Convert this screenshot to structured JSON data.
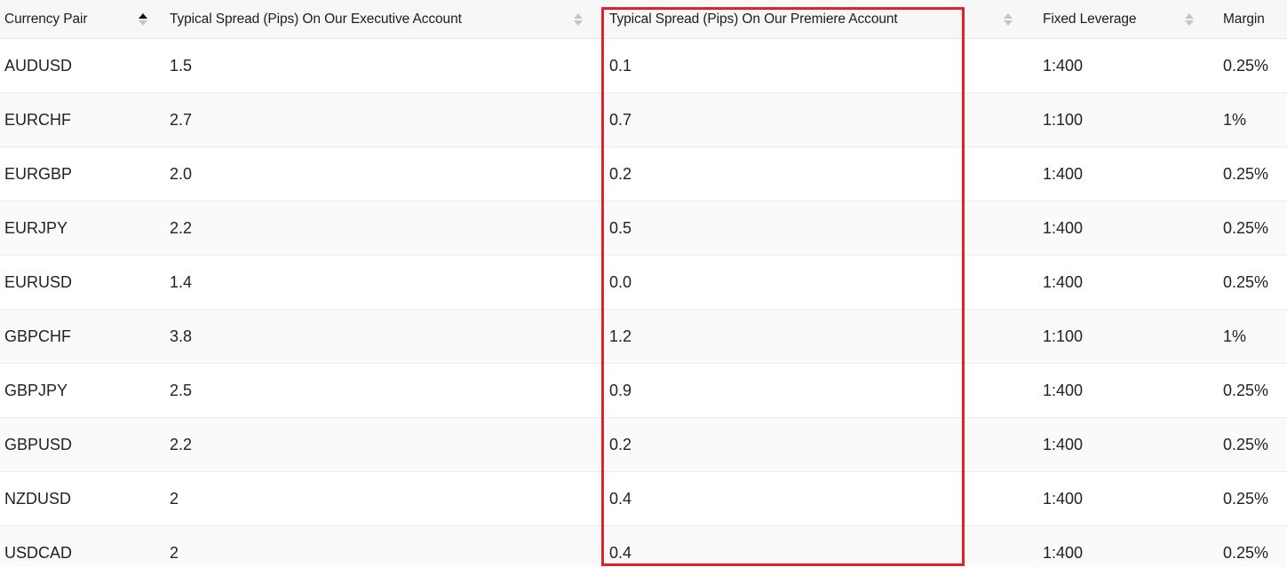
{
  "table": {
    "columns": [
      "Currency Pair",
      "Typical Spread (Pips) On Our Executive Account",
      "Typical Spread (Pips) On Our Premiere Account",
      "Fixed Leverage",
      "Margin"
    ],
    "rows": [
      [
        "AUDUSD",
        "1.5",
        "0.1",
        "1:400",
        "0.25%"
      ],
      [
        "EURCHF",
        "2.7",
        "0.7",
        "1:100",
        "1%"
      ],
      [
        "EURGBP",
        "2.0",
        "0.2",
        "1:400",
        "0.25%"
      ],
      [
        "EURJPY",
        "2.2",
        "0.5",
        "1:400",
        "0.25%"
      ],
      [
        "EURUSD",
        "1.4",
        "0.0",
        "1:400",
        "0.25%"
      ],
      [
        "GBPCHF",
        "3.8",
        "1.2",
        "1:100",
        "1%"
      ],
      [
        "GBPJPY",
        "2.5",
        "0.9",
        "1:400",
        "0.25%"
      ],
      [
        "GBPUSD",
        "2.2",
        "0.2",
        "1:400",
        "0.25%"
      ],
      [
        "NZDUSD",
        "2",
        "0.4",
        "1:400",
        "0.25%"
      ],
      [
        "USDCAD",
        "2",
        "0.4",
        "1:400",
        "0.25%"
      ]
    ]
  },
  "icons": {
    "sort": "sort-arrows-icon",
    "sort_active": "sort-ascending-icon"
  },
  "colors": {
    "highlight": "#e0222d",
    "sort_active": "#111111",
    "sort_inactive": "#c4c4c4"
  }
}
